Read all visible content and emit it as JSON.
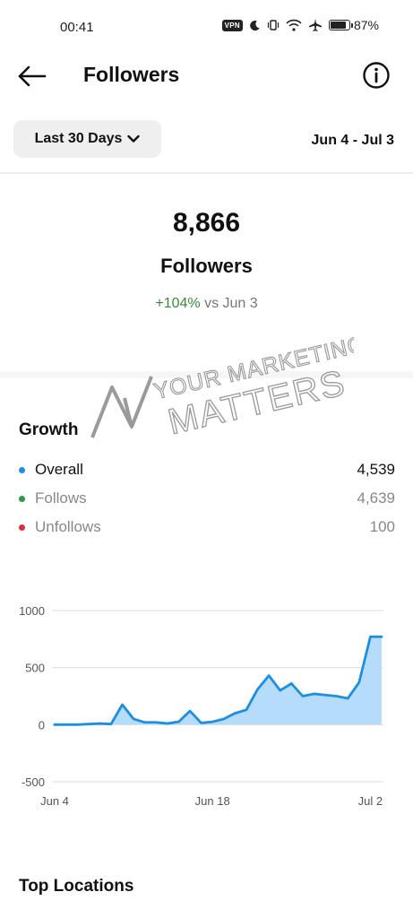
{
  "status_bar": {
    "time": "00:41",
    "vpn": "VPN",
    "battery_percent": "87%",
    "battery_level": 0.87
  },
  "header": {
    "title": "Followers",
    "back_icon": "back-arrow-icon",
    "info_icon": "info-icon"
  },
  "filter": {
    "range_label": "Last 30 Days",
    "date_range": "Jun 4 - Jul 3"
  },
  "summary": {
    "total": "8,866",
    "label": "Followers",
    "change_pct": "+104%",
    "change_ref": "vs Jun 3"
  },
  "watermark": {
    "line1": "YOUR MARKETING",
    "line2": "MATTERS"
  },
  "growth": {
    "title": "Growth",
    "items": [
      {
        "label": "Overall",
        "value": "4,539",
        "color": "#1e8fe0"
      },
      {
        "label": "Follows",
        "value": "4,639",
        "color": "#2e9a46"
      },
      {
        "label": "Unfollows",
        "value": "100",
        "color": "#d9303e"
      }
    ]
  },
  "chart_data": {
    "type": "area",
    "title": "",
    "xlabel": "",
    "ylabel": "",
    "ylim": [
      -500,
      1000
    ],
    "y_ticks": [
      "1000",
      "500",
      "0",
      "-500"
    ],
    "x_tick_labels": [
      "Jun 4",
      "Jun 18",
      "Jul 2"
    ],
    "grid": true,
    "series": [
      {
        "color": "#1e8fe0",
        "fill": "#b5dcfa",
        "x": [
          "Jun 4",
          "Jun 5",
          "Jun 6",
          "Jun 7",
          "Jun 8",
          "Jun 9",
          "Jun 10",
          "Jun 11",
          "Jun 12",
          "Jun 13",
          "Jun 14",
          "Jun 15",
          "Jun 16",
          "Jun 17",
          "Jun 18",
          "Jun 19",
          "Jun 20",
          "Jun 21",
          "Jun 22",
          "Jun 23",
          "Jun 24",
          "Jun 25",
          "Jun 26",
          "Jun 27",
          "Jun 28",
          "Jun 29",
          "Jun 30",
          "Jul 1",
          "Jul 2",
          "Jul 3"
        ],
        "values": [
          0,
          0,
          0,
          5,
          10,
          5,
          175,
          50,
          20,
          20,
          10,
          25,
          120,
          15,
          25,
          50,
          100,
          130,
          310,
          430,
          300,
          360,
          250,
          270,
          260,
          250,
          230,
          370,
          770,
          770
        ]
      }
    ]
  },
  "locations": {
    "title": "Top Locations"
  }
}
